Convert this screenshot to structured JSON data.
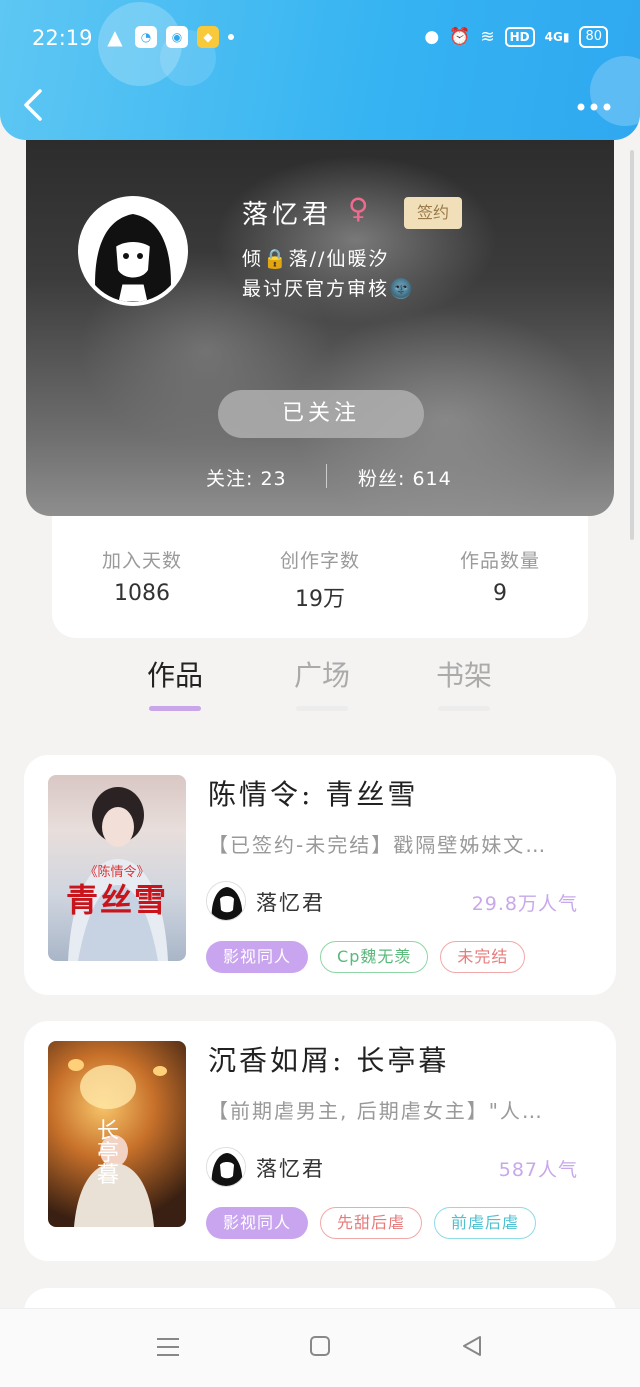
{
  "status_bar": {
    "time": "22:19",
    "battery": "80",
    "hd_label": "HD",
    "network": "4G"
  },
  "header": {
    "back_icon": "chevron-left-icon",
    "more_icon": "more-horizontal-icon"
  },
  "profile": {
    "username": "落忆君",
    "gender_symbol": "♀",
    "badge": "签约",
    "bio_line1": "倾🔒落//仙暖汐",
    "bio_line2": "最讨厌官方审核🌚",
    "follow_button": "已关注",
    "following_text": "关注: 23",
    "fans_text": "粉丝: 614"
  },
  "stats": [
    {
      "label": "加入天数",
      "value": "1086"
    },
    {
      "label": "创作字数",
      "value": "19万"
    },
    {
      "label": "作品数量",
      "value": "9"
    }
  ],
  "tabs": [
    {
      "label": "作品",
      "active": true
    },
    {
      "label": "广场",
      "active": false
    },
    {
      "label": "书架",
      "active": false
    }
  ],
  "works": [
    {
      "title": "陈情令: 青丝雪",
      "desc": "【已签约-未完结】戳隔壁姊妹文…",
      "author": "落忆君",
      "popularity": "29.8万人气",
      "cover_small": "《陈情令》",
      "cover_big": "青丝雪",
      "tags": [
        "影视同人",
        "Cp魏无羡",
        "未完结"
      ]
    },
    {
      "title": "沉香如屑: 长亭暮",
      "desc": "【前期虐男主, 后期虐女主】\"人…",
      "author": "落忆君",
      "popularity": "587人气",
      "cover_big": "长亭暮",
      "tags": [
        "影视同人",
        "先甜后虐",
        "前虐后虐"
      ]
    }
  ],
  "colors": {
    "header_blue": "#35b3f2",
    "accent_purple": "#c9a5ef",
    "badge_gold": "#f0dfb8"
  }
}
